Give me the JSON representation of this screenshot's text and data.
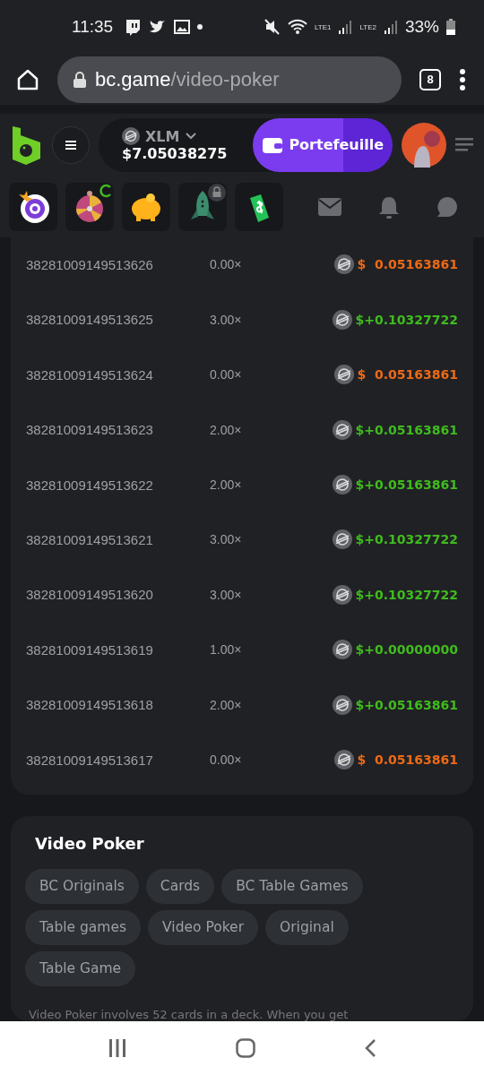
{
  "status_bar": {
    "time": "11:35",
    "sim_labels": [
      "LTE1",
      "LTE2"
    ],
    "battery": "33%"
  },
  "browser": {
    "url_host": "bc.game",
    "url_path": "/video-poker",
    "tab_count": "8"
  },
  "header": {
    "currency": "XLM",
    "balance": "$7.05038275",
    "wallet_button": "Portefeuille"
  },
  "bets": [
    {
      "id": "38281009149513626",
      "payout": "0.00×",
      "kind": "loss",
      "currency_sign": "$",
      "amount": "0.05163861"
    },
    {
      "id": "38281009149513625",
      "payout": "3.00×",
      "kind": "win",
      "currency_sign": "$",
      "amount": "+0.10327722"
    },
    {
      "id": "38281009149513624",
      "payout": "0.00×",
      "kind": "loss",
      "currency_sign": "$",
      "amount": "0.05163861"
    },
    {
      "id": "38281009149513623",
      "payout": "2.00×",
      "kind": "win",
      "currency_sign": "$",
      "amount": "+0.05163861"
    },
    {
      "id": "38281009149513622",
      "payout": "2.00×",
      "kind": "win",
      "currency_sign": "$",
      "amount": "+0.05163861"
    },
    {
      "id": "38281009149513621",
      "payout": "3.00×",
      "kind": "win",
      "currency_sign": "$",
      "amount": "+0.10327722"
    },
    {
      "id": "38281009149513620",
      "payout": "3.00×",
      "kind": "win",
      "currency_sign": "$",
      "amount": "+0.10327722"
    },
    {
      "id": "38281009149513619",
      "payout": "1.00×",
      "kind": "win",
      "currency_sign": "$",
      "amount": "+0.00000000"
    },
    {
      "id": "38281009149513618",
      "payout": "2.00×",
      "kind": "win",
      "currency_sign": "$",
      "amount": "+0.05163861"
    },
    {
      "id": "38281009149513617",
      "payout": "0.00×",
      "kind": "loss",
      "currency_sign": "$",
      "amount": "0.05163861"
    }
  ],
  "game_info": {
    "title": "Video Poker",
    "tags": [
      "BC Originals",
      "Cards",
      "BC Table Games",
      "Table games",
      "Video Poker",
      "Original",
      "Table Game"
    ],
    "description": "Video Poker involves 52 cards in a deck. When you get"
  }
}
